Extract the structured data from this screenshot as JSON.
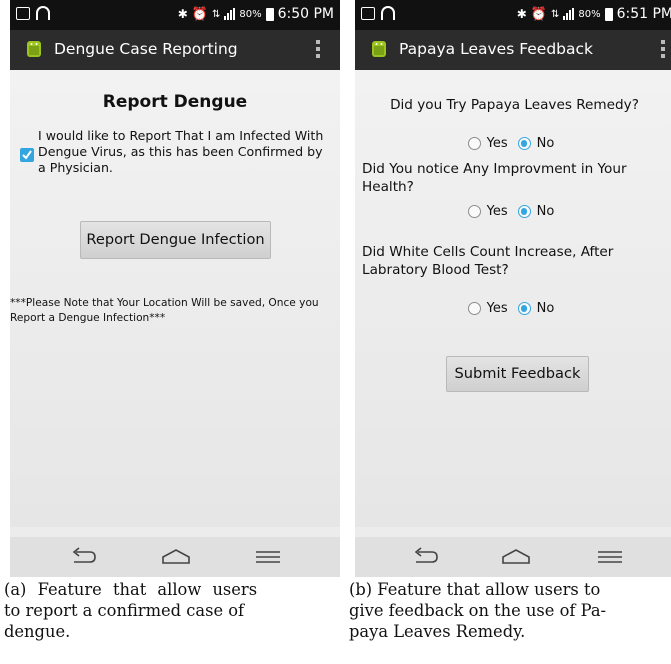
{
  "panel_a": {
    "status": {
      "battery": "80%",
      "time": "6:50 PM"
    },
    "action_bar_title": "Dengue Case Reporting",
    "heading": "Report Dengue",
    "checkbox_label": "I would like to Report That I am Infected With Dengue Virus, as this has been Confirmed by a Physician.",
    "checkbox_checked": true,
    "report_button": "Report Dengue Infection",
    "note": "***Please Note that Your Location Will be saved, Once you Report a Dengue Infection***"
  },
  "panel_b": {
    "status": {
      "battery": "80%",
      "time": "6:51 PM"
    },
    "action_bar_title": "Papaya Leaves Feedback",
    "questions": [
      {
        "text": "Did you Try Papaya Leaves Remedy?",
        "yes": "Yes",
        "no": "No",
        "selected": "No"
      },
      {
        "text": "Did You notice Any Improvment in Your Health?",
        "yes": "Yes",
        "no": "No",
        "selected": "No"
      },
      {
        "text": "Did White Cells Count Increase, After Labratory Blood Test?",
        "yes": "Yes",
        "no": "No",
        "selected": "No"
      }
    ],
    "submit_button": "Submit Feedback"
  },
  "captions": {
    "a": {
      "line1": "(a) Feature that allow users",
      "line2": "to report a confirmed case of",
      "line3": "dengue."
    },
    "b": {
      "line1": "(b) Feature that allow users to",
      "line2": "give feedback on the use of Pa-",
      "line3": "paya Leaves Remedy."
    }
  },
  "colors": {
    "accent": "#33a6e0",
    "action_bar": "#2c2c2c",
    "status_bar": "#111111",
    "android_green": "#9bc41f"
  },
  "icons": [
    "image-icon",
    "wifi-icon",
    "bluetooth-icon",
    "alarm-icon",
    "4g-icon",
    "signal-icon",
    "battery-icon",
    "android-icon",
    "overflow-menu-icon",
    "back-icon",
    "home-icon",
    "menu-icon"
  ]
}
